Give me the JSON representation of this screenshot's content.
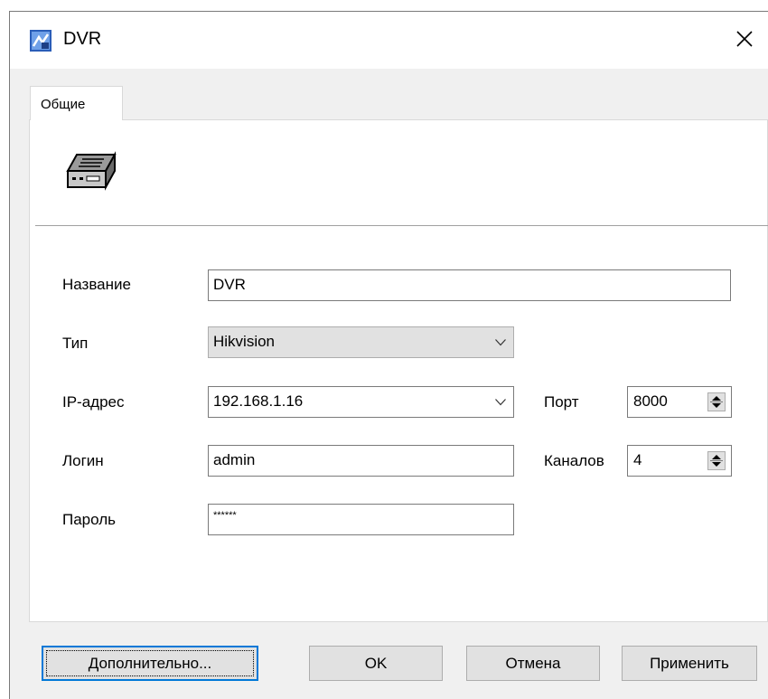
{
  "window": {
    "title": "DVR"
  },
  "tabs": [
    {
      "label": "Общие"
    }
  ],
  "form": {
    "name": {
      "label": "Название",
      "value": "DVR"
    },
    "type": {
      "label": "Тип",
      "value": "Hikvision"
    },
    "ip": {
      "label": "IP-адрес",
      "value": "192.168.1.16"
    },
    "port": {
      "label": "Порт",
      "value": "8000"
    },
    "login": {
      "label": "Логин",
      "value": "admin"
    },
    "channels": {
      "label": "Каналов",
      "value": "4"
    },
    "password": {
      "label": "Пароль",
      "value": "******"
    }
  },
  "buttons": {
    "advanced": "Дополнительно...",
    "ok": "OK",
    "cancel": "Отмена",
    "apply": "Применить"
  },
  "icons": {
    "app": "app-icon",
    "device": "dvr-device-icon",
    "close": "close-icon"
  },
  "colors": {
    "focus_border": "#0078d7",
    "window_bg": "#f0f0f0"
  }
}
